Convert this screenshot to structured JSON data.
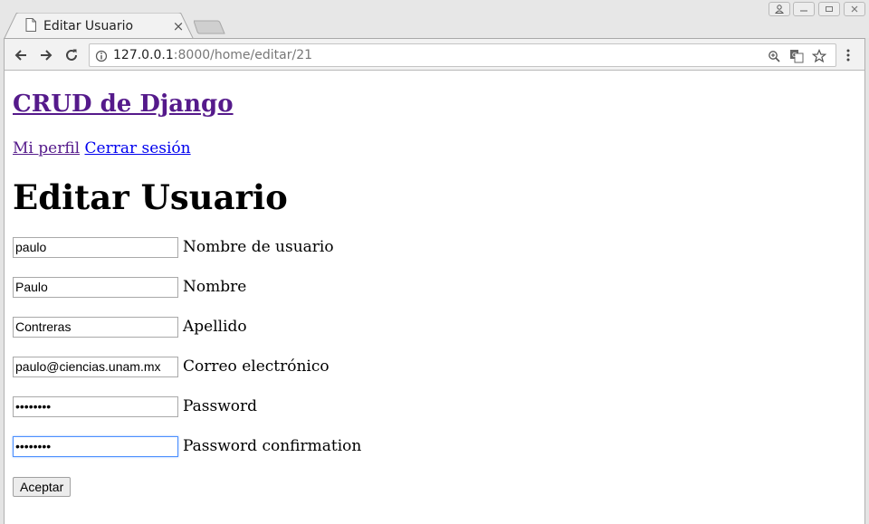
{
  "browser": {
    "tab_title": "Editar Usuario",
    "tab_close": "×",
    "url_host": "127.0.0.1",
    "url_rest": ":8000/home/editar/21"
  },
  "page": {
    "site_title": "CRUD de Django",
    "nav": {
      "profile": "Mi perfil",
      "logout": "Cerrar sesión"
    },
    "heading": "Editar Usuario",
    "fields": [
      {
        "label": "Nombre de usuario",
        "value": "paulo",
        "type": "text"
      },
      {
        "label": "Nombre",
        "value": "Paulo",
        "type": "text"
      },
      {
        "label": "Apellido",
        "value": "Contreras",
        "type": "text"
      },
      {
        "label": "Correo electrónico",
        "value": "paulo@ciencias.unam.mx",
        "type": "text"
      },
      {
        "label": "Password",
        "value": "••••••••",
        "type": "password"
      },
      {
        "label": "Password confirmation",
        "value": "••••••••",
        "type": "password"
      }
    ],
    "submit": "Aceptar"
  },
  "colors": {
    "visited_link": "#551a8b",
    "link": "#0000ee",
    "focus": "#4d90fe"
  }
}
